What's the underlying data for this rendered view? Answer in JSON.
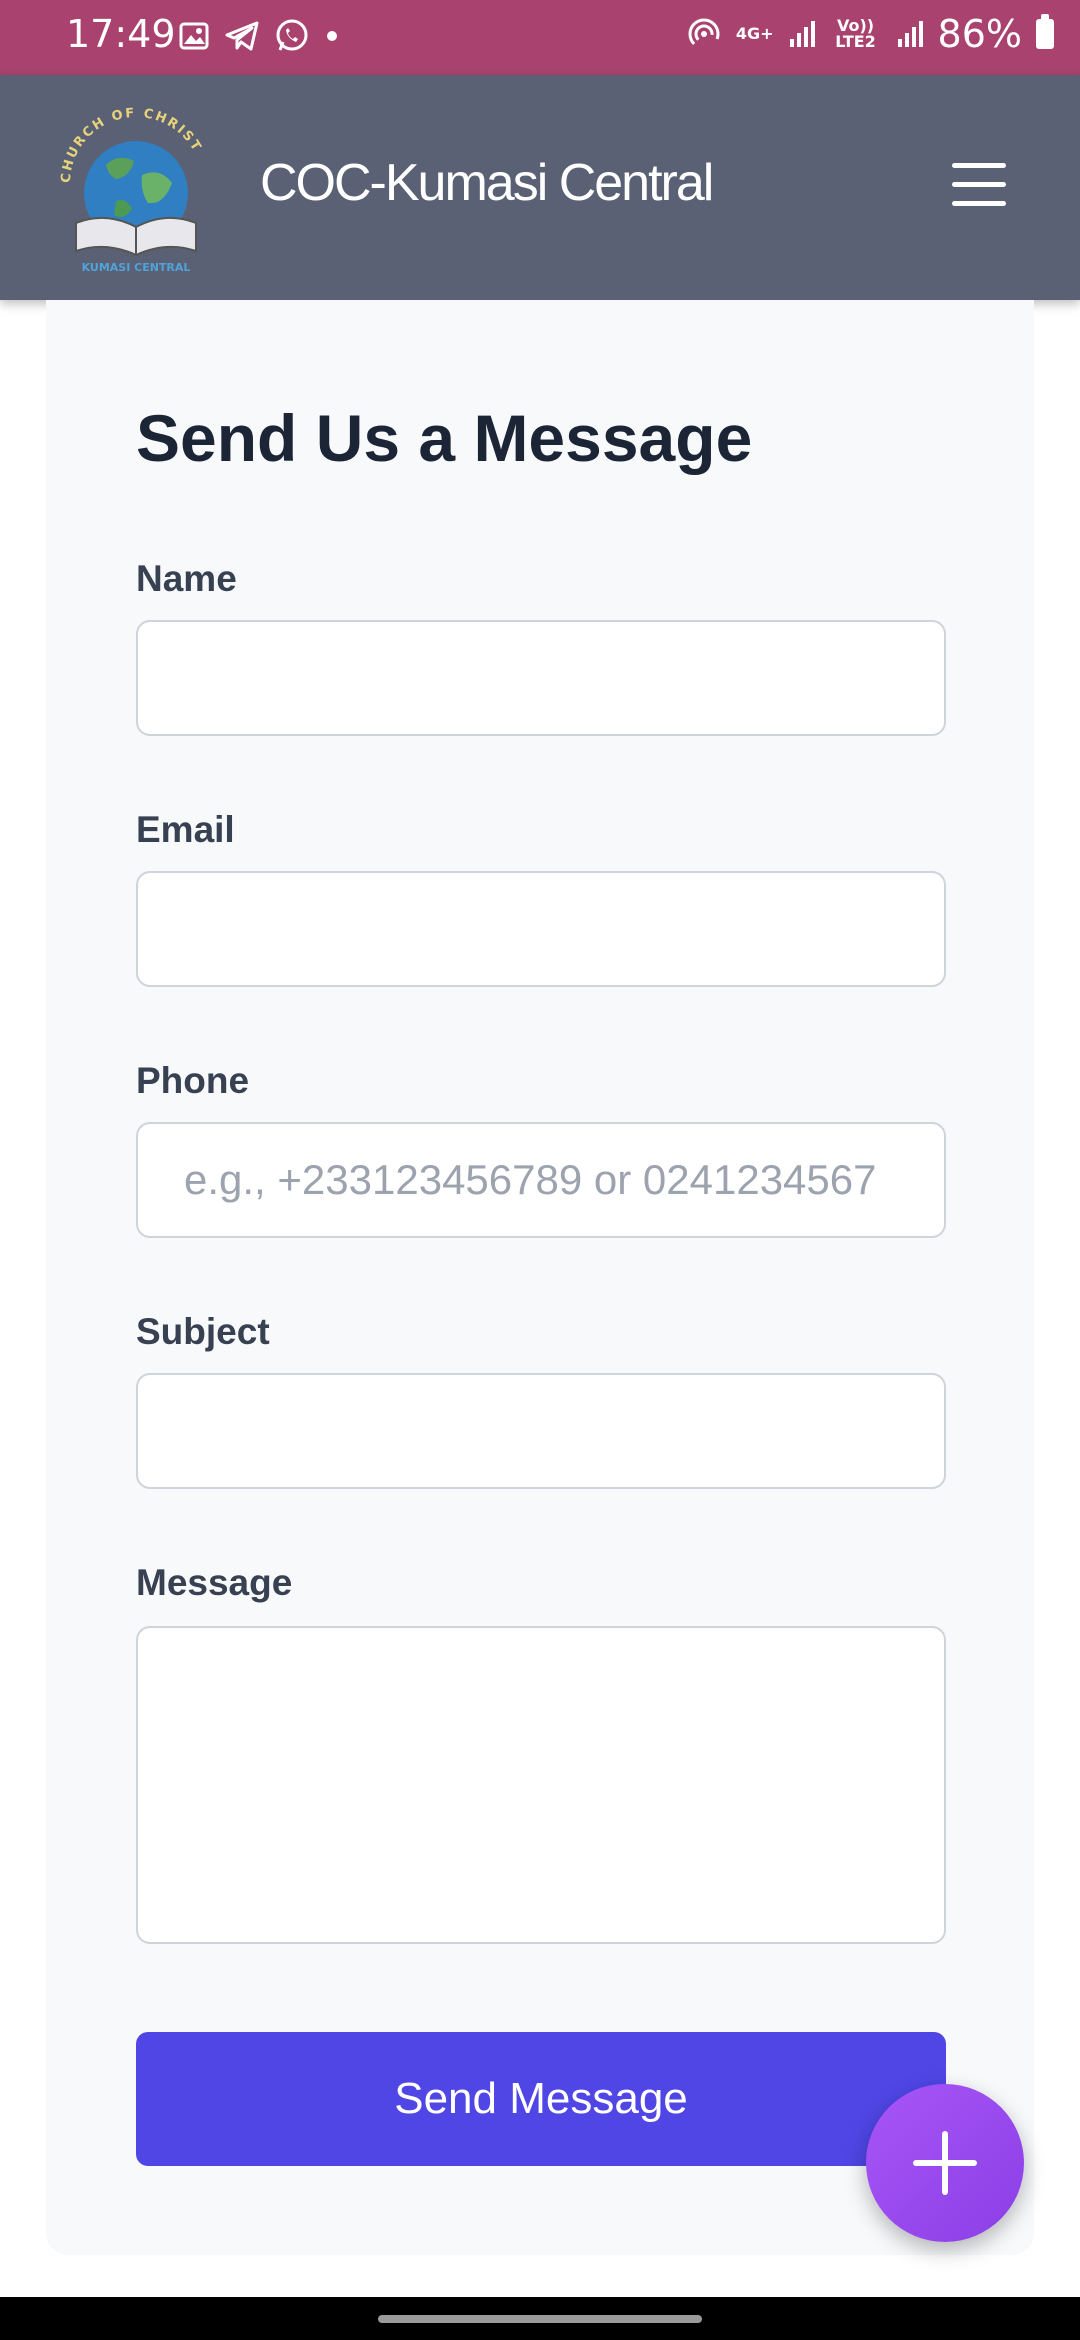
{
  "status_bar": {
    "time": "17:49",
    "network_top": "4G+",
    "network_bottom": "Vo)) LTE2",
    "battery": "86%"
  },
  "header": {
    "title": "COC-Kumasi Central",
    "logo_text_top": "CHURCH OF CHRIST",
    "logo_text_bottom": "KUMASI CENTRAL"
  },
  "form": {
    "title": "Send Us a Message",
    "fields": {
      "name": {
        "label": "Name",
        "value": "",
        "placeholder": ""
      },
      "email": {
        "label": "Email",
        "value": "",
        "placeholder": ""
      },
      "phone": {
        "label": "Phone",
        "value": "",
        "placeholder": "e.g., +233123456789 or 0241234567"
      },
      "subject": {
        "label": "Subject",
        "value": "",
        "placeholder": ""
      },
      "message": {
        "label": "Message",
        "value": "",
        "placeholder": ""
      }
    },
    "submit_label": "Send Message"
  },
  "colors": {
    "status_bar": "#a9426f",
    "header": "#5a6175",
    "primary_button": "#4f46e5",
    "fab": "#a855f7"
  },
  "icons": {
    "menu": "hamburger-menu-icon",
    "fab": "plus-icon"
  }
}
